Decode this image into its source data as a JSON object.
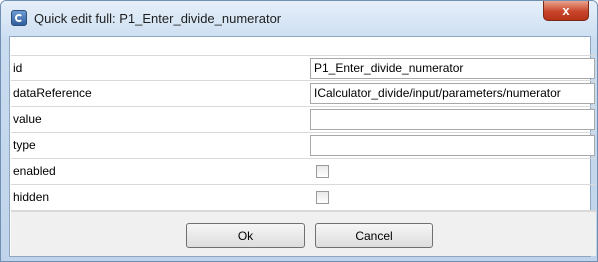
{
  "window": {
    "title": "Quick edit full: P1_Enter_divide_numerator",
    "close_glyph": "x"
  },
  "properties": [
    {
      "name": "id",
      "kind": "text",
      "value": "P1_Enter_divide_numerator"
    },
    {
      "name": "dataReference",
      "kind": "text",
      "value": "ICalculator_divide/input/parameters/numerator"
    },
    {
      "name": "value",
      "kind": "text",
      "value": ""
    },
    {
      "name": "type",
      "kind": "text",
      "value": ""
    },
    {
      "name": "enabled",
      "kind": "checkbox",
      "checked": false
    },
    {
      "name": "hidden",
      "kind": "checkbox",
      "checked": false
    }
  ],
  "buttons": {
    "ok_label": "Ok",
    "cancel_label": "Cancel"
  }
}
